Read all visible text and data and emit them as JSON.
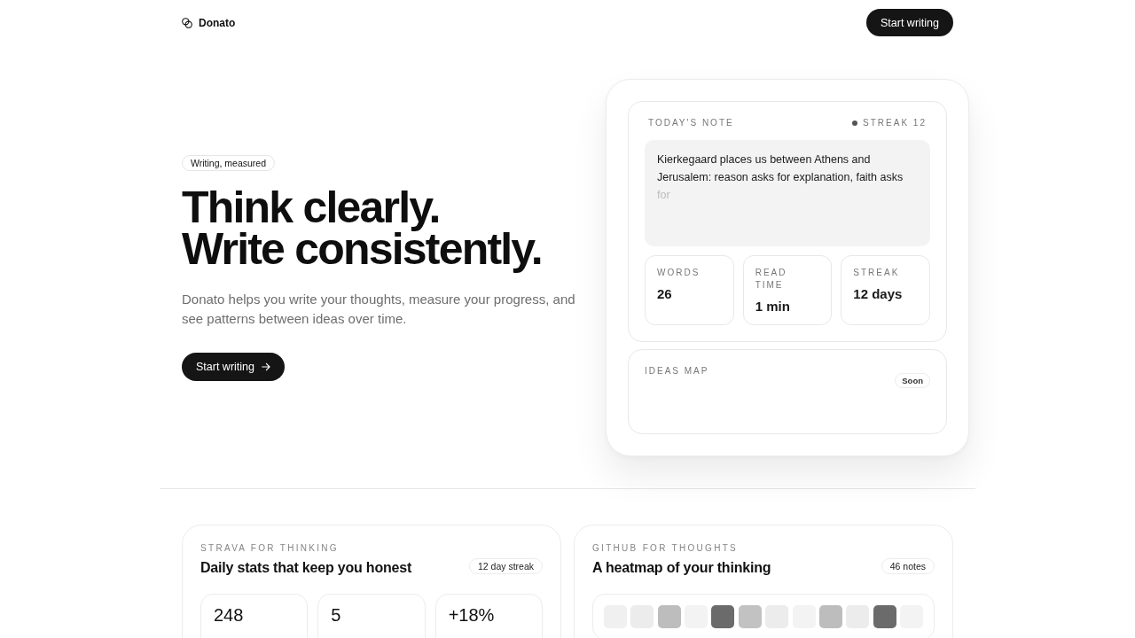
{
  "header": {
    "brand": "Donato",
    "cta": "Start writing"
  },
  "hero": {
    "badge": "Writing, measured",
    "title_lines": [
      "Think clearly.",
      "Write consistently."
    ],
    "description": "Donato helps you write your thoughts, measure your progress, and see patterns between ideas over time.",
    "cta": "Start writing"
  },
  "preview_card": {
    "note": {
      "label": "TODAY'S NOTE",
      "streak": "STREAK 12",
      "text": "Kierkegaard places us between Athens and Jerusalem: reason asks for explanation, faith asks",
      "faded_text": "for"
    },
    "stats": [
      {
        "label": "WORDS",
        "value": "26"
      },
      {
        "label": "READ TIME",
        "value": "1 min"
      },
      {
        "label": "STREAK",
        "value": "12 days"
      }
    ],
    "ideas_map": {
      "label": "IDEAS MAP",
      "badge": "Soon"
    }
  },
  "features": [
    {
      "kind": "stats",
      "eyebrow": "STRAVA FOR THINKING",
      "title": "Daily stats that keep you honest",
      "badge": "12 day streak",
      "stats": [
        {
          "value": "248"
        },
        {
          "value": "5"
        },
        {
          "value": "+18%"
        }
      ]
    },
    {
      "kind": "heatmap",
      "eyebrow": "GITHUB FOR THOUGHTS",
      "title": "A heatmap of your thinking",
      "badge": "46 notes",
      "cells": [
        {
          "color": "#f0f0f0"
        },
        {
          "color": "#ececec"
        },
        {
          "color": "#bdbdbd"
        },
        {
          "color": "#f3f3f3"
        },
        {
          "color": "#6b6b6b"
        },
        {
          "color": "#c2c2c2"
        },
        {
          "color": "#ececec"
        },
        {
          "color": "#f3f3f3"
        },
        {
          "color": "#bdbdbd"
        },
        {
          "color": "#ececec"
        },
        {
          "color": "#6b6b6b"
        },
        {
          "color": "#f3f3f3"
        }
      ]
    }
  ]
}
